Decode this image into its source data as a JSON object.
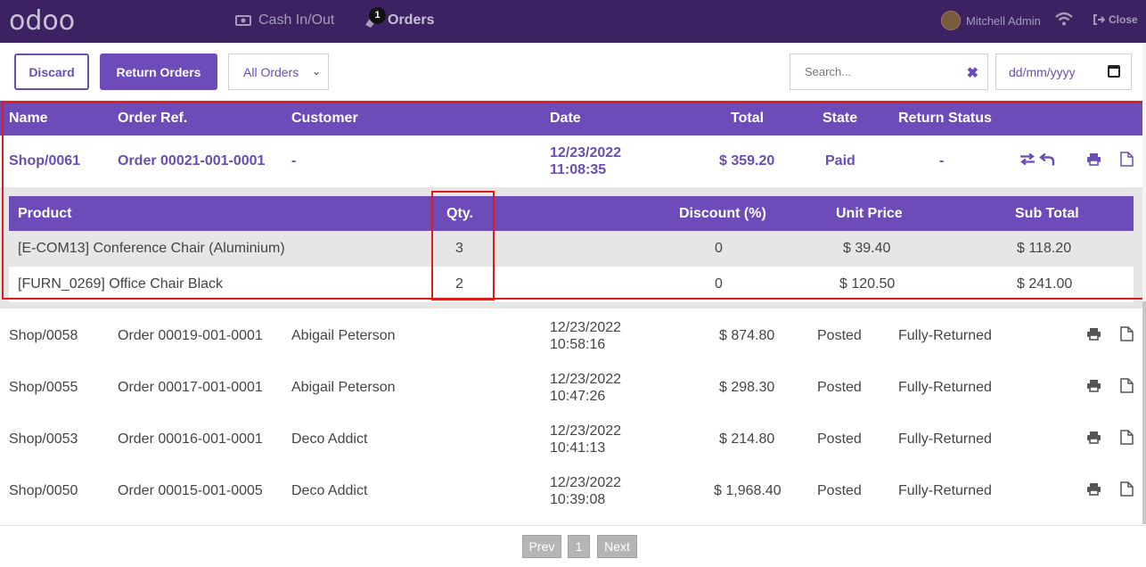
{
  "app": {
    "logo": "odoo",
    "nav": {
      "cash": "Cash In/Out",
      "orders": "Orders",
      "orders_badge": "1"
    },
    "user": "Mitchell Admin",
    "close": "Close"
  },
  "toolbar": {
    "discard": "Discard",
    "return_orders": "Return Orders",
    "filter_selected": "All Orders",
    "search_placeholder": "Search...",
    "date_placeholder": "dd/mm/yyyy"
  },
  "table": {
    "headers": [
      "Name",
      "Order Ref.",
      "Customer",
      "Date",
      "Total",
      "State",
      "Return Status"
    ],
    "selected": {
      "name": "Shop/0061",
      "ref": "Order 00021-001-0001",
      "customer": "-",
      "date": "12/23/2022",
      "time": "11:08:35",
      "total": "$ 359.20",
      "state": "Paid",
      "return_status": "-"
    },
    "detail": {
      "headers": [
        "Product",
        "Qty.",
        "Discount (%)",
        "Unit Price",
        "Sub Total"
      ],
      "lines": [
        {
          "product": "[E-COM13] Conference Chair (Aluminium)",
          "qty": "3",
          "discount": "0",
          "unit_price": "$ 39.40",
          "subtotal": "$ 118.20"
        },
        {
          "product": "[FURN_0269] Office Chair Black",
          "qty": "2",
          "discount": "0",
          "unit_price": "$ 120.50",
          "subtotal": "$ 241.00"
        }
      ]
    },
    "rows": [
      {
        "name": "Shop/0058",
        "ref": "Order 00019-001-0001",
        "customer": "Abigail Peterson",
        "date": "12/23/2022",
        "time": "10:58:16",
        "total": "$ 874.80",
        "state": "Posted",
        "return_status": "Fully-Returned"
      },
      {
        "name": "Shop/0055",
        "ref": "Order 00017-001-0001",
        "customer": "Abigail Peterson",
        "date": "12/23/2022",
        "time": "10:47:26",
        "total": "$ 298.30",
        "state": "Posted",
        "return_status": "Fully-Returned"
      },
      {
        "name": "Shop/0053",
        "ref": "Order 00016-001-0001",
        "customer": "Deco Addict",
        "date": "12/23/2022",
        "time": "10:41:13",
        "total": "$ 214.80",
        "state": "Posted",
        "return_status": "Fully-Returned"
      },
      {
        "name": "Shop/0050",
        "ref": "Order 00015-001-0005",
        "customer": "Deco Addict",
        "date": "12/23/2022",
        "time": "10:39:08",
        "total": "$ 1,968.40",
        "state": "Posted",
        "return_status": "Fully-Returned"
      }
    ]
  },
  "pager": {
    "prev": "Prev",
    "page": "1",
    "next": "Next"
  },
  "colors": {
    "brand": "#3c2262",
    "accent": "#6d4cba",
    "highlight": "#e01b1b"
  },
  "icons": [
    "cash-icon",
    "orders-icon",
    "wifi-icon",
    "close-icon",
    "search-clear-icon",
    "calendar-icon",
    "exchange-icon",
    "return-icon",
    "print-icon",
    "file-icon"
  ]
}
